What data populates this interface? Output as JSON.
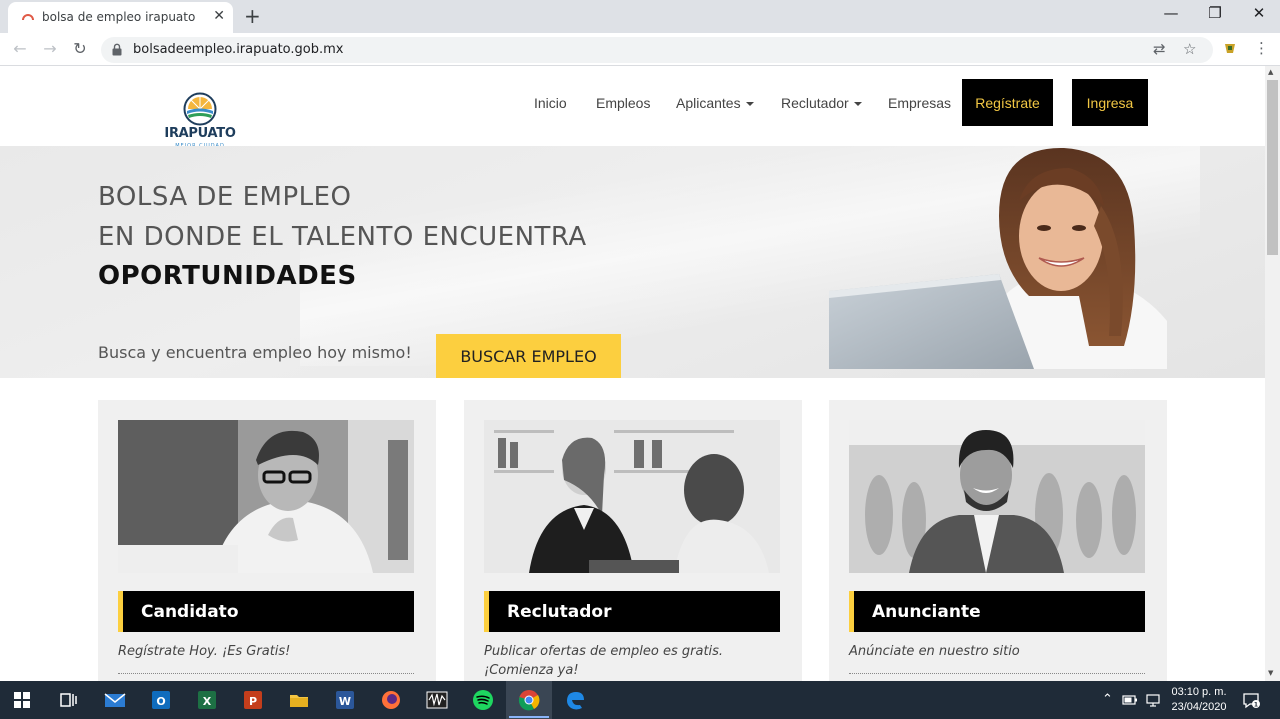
{
  "browser": {
    "tab_title": "bolsa de empleo irapuato",
    "tab_close": "✕",
    "new_tab": "+",
    "minimize": "—",
    "restore": "❐",
    "close": "✕",
    "back": "←",
    "forward": "→",
    "reload": "↻",
    "url": "bolsadeempleo.irapuato.gob.mx",
    "translate_icon": "⇄",
    "bookmark_icon": "☆",
    "menu_icon": "⋮"
  },
  "site": {
    "logo_text": "IRAPUATO",
    "logo_sub": "MEJOR CIUDAD",
    "nav": {
      "inicio": "Inicio",
      "empleos": "Empleos",
      "aplicantes": "Aplicantes",
      "reclutador": "Reclutador",
      "empresas": "Empresas",
      "registrate": "Regístrate",
      "ingresa": "Ingresa"
    },
    "hero": {
      "line1": "BOLSA DE EMPLEO",
      "line2": "EN DONDE EL TALENTO ENCUENTRA",
      "line3": "OPORTUNIDADES",
      "subtitle": "Busca y encuentra empleo hoy mismo!",
      "button": "BUSCAR EMPLEO"
    },
    "cards": [
      {
        "title": "Candidato",
        "description": "Regístrate Hoy. ¡Es Gratis!"
      },
      {
        "title": "Reclutador",
        "description": "Publicar ofertas de empleo es gratis. ¡Comienza ya!"
      },
      {
        "title": "Anunciante",
        "description": "Anúnciate en nuestro sitio"
      }
    ]
  },
  "taskbar": {
    "clock_time": "03:10 p. m.",
    "clock_date": "23/04/2020",
    "tray_chevron": "⌃",
    "notification_badge": "1"
  },
  "colors": {
    "accent_yellow": "#fccf3f",
    "cta_text_yellow": "#f2c744",
    "cta_black": "#000000"
  }
}
